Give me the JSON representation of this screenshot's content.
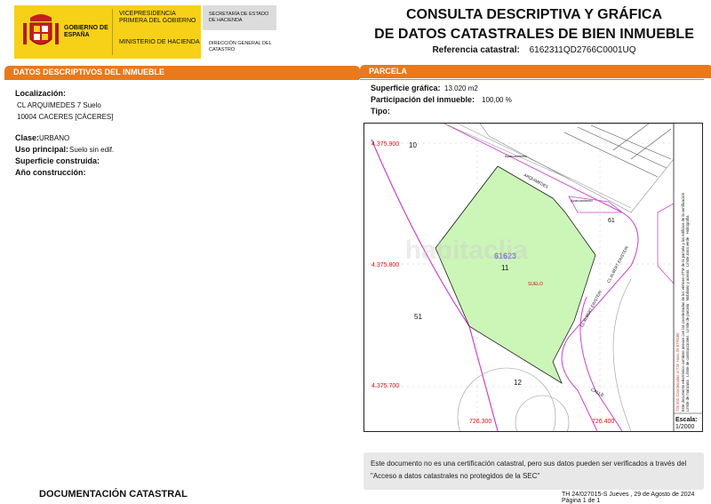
{
  "header": {
    "gobierno": "GOBIERNO DE ESPAÑA",
    "vicepresidencia": "VICEPRESIDENCIA PRIMERA DEL GOBIERNO",
    "ministerio": "MINISTERIO DE HACIENDA",
    "secretaria": "SECRETARÍA DE ESTADO DE HACIENDA",
    "direccion": "DIRECCIÓN GENERAL DEL CATASTRO",
    "title_line1": "CONSULTA DESCRIPTIVA Y GRÁFICA",
    "title_line2": "DE DATOS CATASTRALES DE BIEN INMUEBLE",
    "ref_label": "Referencia catastral:",
    "ref_value": "6162311QD2766C0001UQ"
  },
  "left": {
    "section_title": "DATOS DESCRIPTIVOS DEL INMUEBLE",
    "localizacion_label": "Localización:",
    "localizacion_line1": "CL ARQUIMEDES 7 Suelo",
    "localizacion_line2": "10004 CACERES [CÁCERES]",
    "clase_label": "Clase:",
    "clase_value": "URBANO",
    "uso_label": "Uso principal:",
    "uso_value": "Suelo sin edif.",
    "superficie_label": "Superficie construida:",
    "anio_label": "Año construcción:"
  },
  "right": {
    "section_title": "PARCELA",
    "sup_label": "Superficie gráfica:",
    "sup_value": "13.020 m2",
    "part_label": "Participación del inmueble:",
    "part_value": "100,00 %",
    "tipo_label": "Tipo:"
  },
  "map": {
    "coord_y1": "4.375.900",
    "coord_y2": "4.375.800",
    "coord_y3": "4.375.700",
    "coord_x1": "726.300",
    "coord_x2": "726.400",
    "parcel_id": "61623",
    "parcel_num": "11",
    "parcel_type": "SUELO",
    "n10": "10",
    "n51": "51",
    "n12": "12",
    "n61": "61",
    "street1": "ARQUIMEDES",
    "street2": "CL ALBERT EINSTEIN",
    "street3": "CL ALBERT EINSTEIN",
    "street4": "CALLE",
    "apart1": "Aparcamiento",
    "apart2": "Aparcamiento",
    "watermark": "habitaclia",
    "legend1": "Límite de parcela",
    "legend2": "Límite de construcciones",
    "legend3": "Mobiliario y aceras",
    "legend4": "Límite zona verde",
    "legend5": "Hidrografía",
    "legend6": "Límite de manzana",
    "legend7": "Este documento electrónico contiene anexos con las coordenadas de los vértices UTM de la parcela y los edificios de la certificación",
    "legend8": "726.500 Coordenadas U.T.M. Huso 29 ETRS89",
    "escala_label": "Escala:",
    "escala_value": "1/2000",
    "colors": {
      "parcel_fill": "#ccf5b8",
      "boundary": "#cc44cc",
      "coords": "#e01010"
    }
  },
  "disclaimer": "Este documento no es una certificación catastral, pero sus datos pueden ser verificados a través del \"Acceso a datos catastrales no protegidos de la SEC\"",
  "footer": {
    "left": "DOCUMENTACIÓN CATASTRAL",
    "right": "TH 24/027015-S   Jueves , 29 de Agosto de 2024   Página 1 de 1"
  }
}
